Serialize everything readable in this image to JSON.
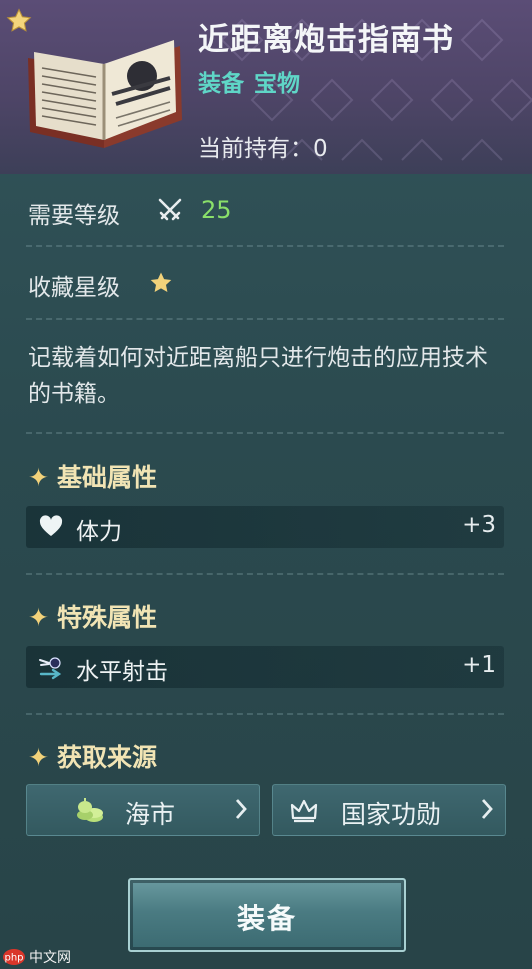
{
  "item": {
    "name": "近距离炮击指南书",
    "type_tags": [
      "装备",
      "宝物"
    ],
    "owned_label": "当前持有：",
    "owned_count": "0",
    "icon": "open-book-icon"
  },
  "requirements": {
    "level_label": "需要等级",
    "level_icon": "crossed-swords-icon",
    "level_value": "25",
    "favorite_label": "收藏星级",
    "favorite_stars": 1
  },
  "description": "记载着如何对近距离船只进行炮击的应用技术的书籍。",
  "base_attributes": {
    "title": "基础属性",
    "items": [
      {
        "icon": "heart-icon",
        "label": "体力",
        "value": "+3"
      }
    ]
  },
  "special_attributes": {
    "title": "特殊属性",
    "items": [
      {
        "icon": "horizontal-shot-icon",
        "label": "水平射击",
        "value": "+1"
      }
    ]
  },
  "sources": {
    "title": "获取来源",
    "items": [
      {
        "icon": "coins-icon",
        "label": "海市"
      },
      {
        "icon": "crown-icon",
        "label": "国家功勋"
      }
    ]
  },
  "equip_button": "装备",
  "watermark": {
    "logo": "php",
    "text": "中文网"
  },
  "colors": {
    "type_tag": "#5fd6c7",
    "level_value": "#8ae06a",
    "section_title": "#f1e4b4",
    "star": "#f2d27a"
  }
}
